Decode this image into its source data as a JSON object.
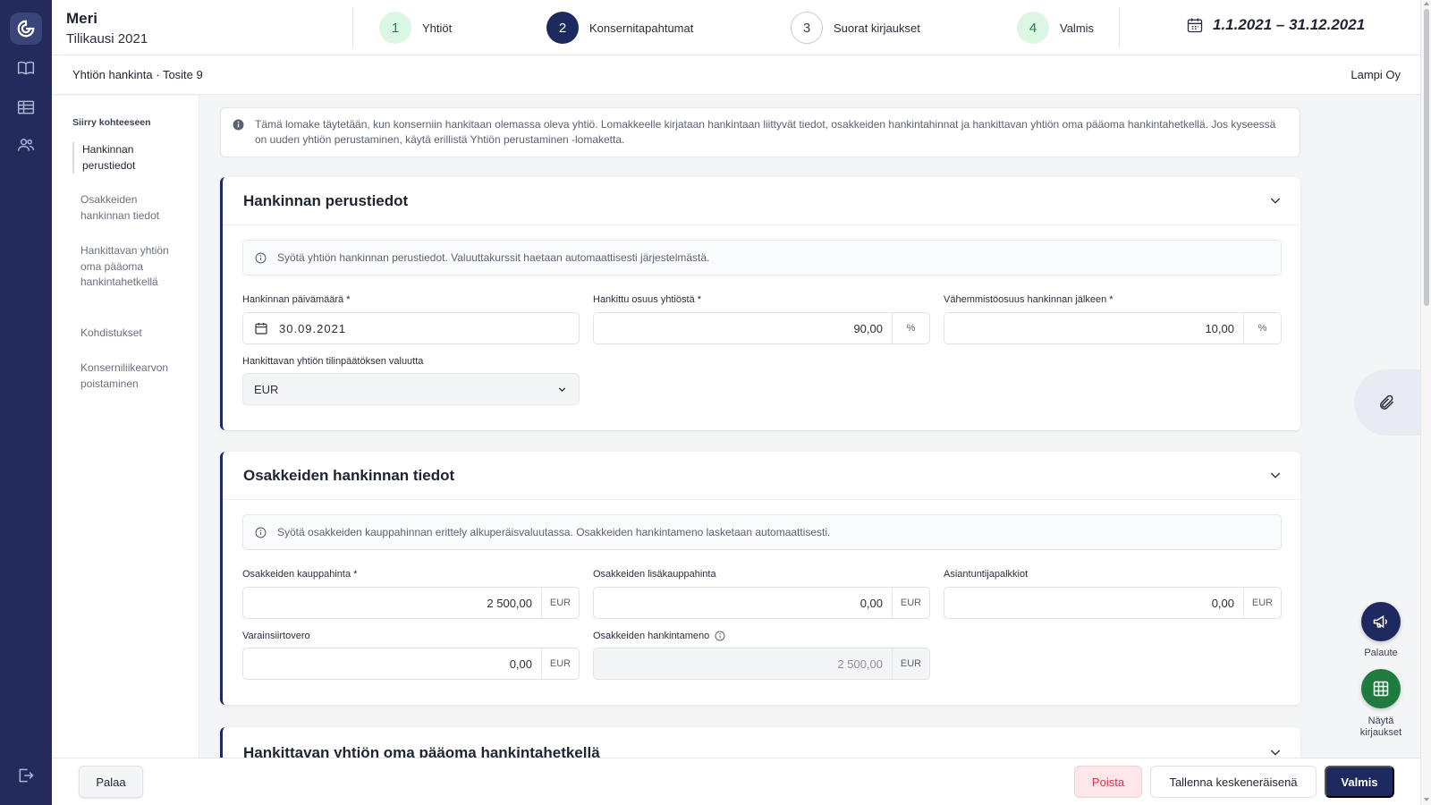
{
  "header": {
    "app_name": "Meri",
    "period": "Tilikausi 2021",
    "steps": [
      {
        "num": "1",
        "label": "Yhtiöt",
        "state": "done"
      },
      {
        "num": "2",
        "label": "Konsernitapahtumat",
        "state": "active"
      },
      {
        "num": "3",
        "label": "Suorat kirjaukset",
        "state": "todo"
      },
      {
        "num": "4",
        "label": "Valmis",
        "state": "done"
      }
    ],
    "date_range": "1.1.2021 – 31.12.2021"
  },
  "subheader": {
    "breadcrumb": "Yhtiön hankinta · Tosite 9",
    "company": "Lampi Oy"
  },
  "toc": {
    "title": "Siirry kohteeseen",
    "items": [
      {
        "label": "Hankinnan perustiedot"
      },
      {
        "label": "Osakkeiden hankinnan tiedot"
      },
      {
        "label": "Hankittavan yhtiön oma pääoma hankintahetkellä"
      },
      {
        "label": "Kohdistukset"
      },
      {
        "label": "Konserniliikearvon poistaminen"
      }
    ]
  },
  "info": "Tämä lomake täytetään, kun konserniin hankitaan olemassa oleva yhtiö. Lomakkeelle kirjataan hankintaan liittyvät tiedot, osakkeiden hankintahinnat ja hankittavan yhtiön oma pääoma hankintahetkellä. Jos kyseessä on uuden yhtiön perustaminen, käytä erillistä Yhtiön perustaminen -lomaketta.",
  "section1": {
    "title": "Hankinnan perustiedot",
    "hint": "Syötä yhtiön hankinnan perustiedot. Valuuttakurssit haetaan automaattisesti järjestelmästä.",
    "date_label": "Hankinnan päivämäärä *",
    "date_value": "30.09.2021",
    "share_label": "Hankittu osuus yhtiöstä *",
    "share_value": "90,00",
    "share_unit": "%",
    "minority_label": "Vähemmistöosuus hankinnan jälkeen *",
    "minority_value": "10,00",
    "minority_unit": "%",
    "currency_label": "Hankittavan yhtiön tilinpäätöksen valuutta",
    "currency_value": "EUR"
  },
  "section2": {
    "title": "Osakkeiden hankinnan tiedot",
    "hint": "Syötä osakkeiden kauppahinnan erittely alkuperäisvaluutassa. Osakkeiden hankintameno lasketaan automaattisesti.",
    "price_label": "Osakkeiden kauppahinta *",
    "price_value": "2 500,00",
    "extra_label": "Osakkeiden lisäkauppahinta",
    "extra_value": "0,00",
    "fees_label": "Asiantuntijapalkkiot",
    "fees_value": "0,00",
    "tax_label": "Varainsiirtovero",
    "tax_value": "0,00",
    "cost_label": "Osakkeiden hankintameno",
    "cost_value": "2 500,00",
    "unit": "EUR"
  },
  "section3": {
    "title": "Hankittavan yhtiön oma pääoma hankintahetkellä"
  },
  "side": {
    "feedback_label": "Palaute",
    "entries_label": "Näytä kirjaukset"
  },
  "footer": {
    "back": "Palaa",
    "delete": "Poista",
    "save_draft": "Tallenna keskeneräisenä",
    "done": "Valmis"
  },
  "colors": {
    "rail": "#232b5c",
    "primary": "#1e2960",
    "step_done_bg": "#dcf6e4",
    "danger": "#d8334a",
    "feedback_fab": "#1e2960",
    "entries_fab": "#1f7a3e"
  }
}
